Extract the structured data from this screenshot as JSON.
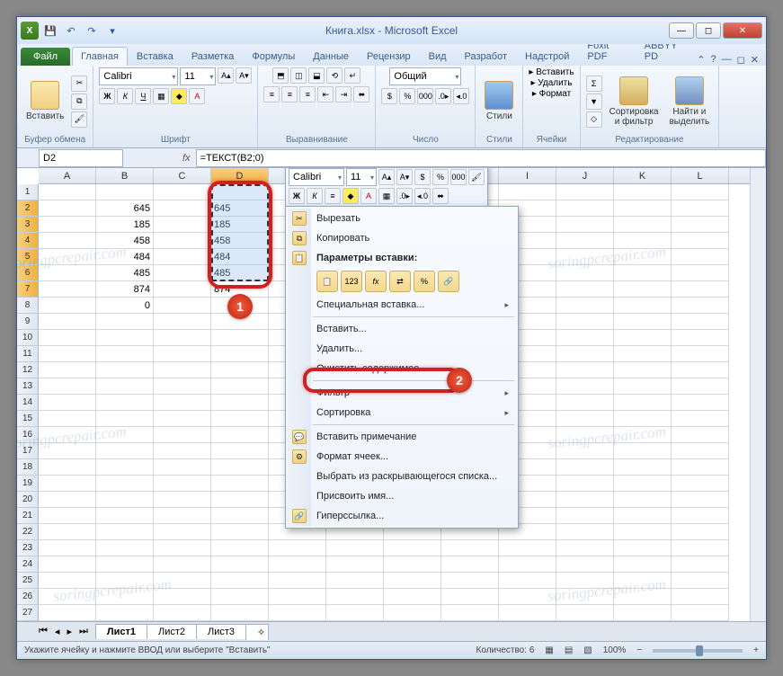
{
  "title": "Книга.xlsx - Microsoft Excel",
  "tabs": {
    "file": "Файл",
    "list": [
      "Главная",
      "Вставка",
      "Разметка",
      "Формулы",
      "Данные",
      "Рецензир",
      "Вид",
      "Разработ",
      "Надстрой",
      "Foxit PDF",
      "ABBYY PD"
    ],
    "active": 0
  },
  "ribbon": {
    "clipboard": {
      "label": "Буфер обмена",
      "paste": "Вставить"
    },
    "font": {
      "label": "Шрифт",
      "name": "Calibri",
      "size": "11"
    },
    "align": {
      "label": "Выравнивание"
    },
    "number": {
      "label": "Число",
      "format": "Общий"
    },
    "styles": {
      "label": "Стили",
      "btn": "Стили"
    },
    "cells": {
      "label": "Ячейки",
      "insert": "Вставить",
      "delete": "Удалить",
      "format": "Формат"
    },
    "editing": {
      "label": "Редактирование",
      "sort": "Сортировка\nи фильтр",
      "find": "Найти и\nвыделить"
    }
  },
  "nameBox": "D2",
  "formula": "=ТЕКСТ(B2;0)",
  "columns": [
    "A",
    "B",
    "C",
    "D",
    "E",
    "F",
    "G",
    "H",
    "I",
    "J",
    "K",
    "L"
  ],
  "selectedCol": 3,
  "rows": 28,
  "selectedRows": [
    2,
    3,
    4,
    5,
    6,
    7
  ],
  "cellData": {
    "B": {
      "2": "645",
      "3": "185",
      "4": "458",
      "5": "484",
      "6": "485",
      "7": "874",
      "8": "0"
    },
    "D": {
      "2": "645",
      "3": "185",
      "4": "458",
      "5": "484",
      "6": "485",
      "7": "874"
    }
  },
  "miniToolbar": {
    "font": "Calibri",
    "size": "11"
  },
  "contextMenu": {
    "cut": "Вырезать",
    "copy": "Копировать",
    "pasteOptsLabel": "Параметры вставки:",
    "pasteSpecial": "Специальная вставка...",
    "insert": "Вставить...",
    "delete": "Удалить...",
    "clear": "Очистить содержимое",
    "filter": "Фильтр",
    "sort": "Сортировка",
    "comment": "Вставить примечание",
    "formatCells": "Формат ячеек...",
    "pickList": "Выбрать из раскрывающегося списка...",
    "defineName": "Присвоить имя...",
    "hyperlink": "Гиперссылка..."
  },
  "sheets": [
    "Лист1",
    "Лист2",
    "Лист3"
  ],
  "status": {
    "msg": "Укажите ячейку и нажмите ВВОД или выберите \"Вставить\"",
    "count_lbl": "Количество:",
    "count_val": "6",
    "zoom": "100%"
  },
  "badges": {
    "one": "1",
    "two": "2"
  },
  "watermark": "soringpcrepair.com"
}
